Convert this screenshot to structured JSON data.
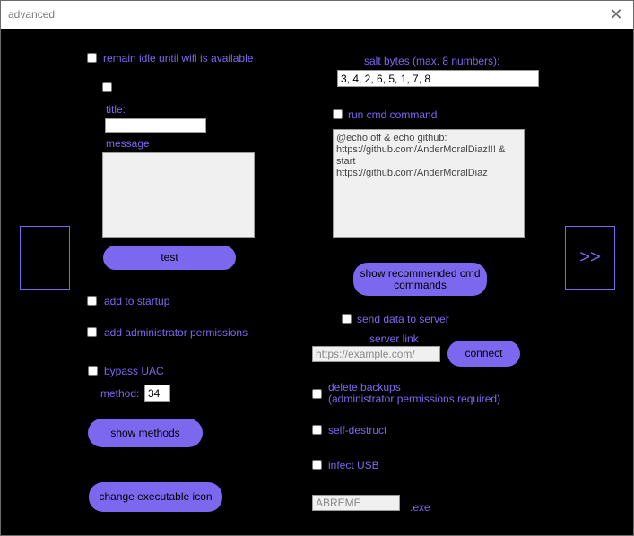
{
  "window": {
    "title": "advanced",
    "close_icon": "✕"
  },
  "left": {
    "remain_idle_label": "remain idle until wifi is available",
    "title_label": "title:",
    "message_label": "message",
    "test_label": "test",
    "startup_label": "add to startup",
    "admin_label": "add administrator permissions",
    "uac_label": "bypass UAC",
    "method_label": "method:",
    "method_value": "34",
    "show_methods_label": "show methods",
    "change_icon_label": "change executable icon"
  },
  "right": {
    "salt_label": "salt bytes (max. 8 numbers):",
    "salt_value": "3, 4, 2, 6, 5, 1, 7, 8",
    "run_cmd_label": "run cmd command",
    "cmd_text": "@echo off & echo github:\nhttps://github.com/AnderMoralDiaz!!! & start\nhttps://github.com/AnderMoralDiaz",
    "show_cmd_label_1": "show recommended cmd",
    "show_cmd_label_2": "commands",
    "send_data_label": "send data to server",
    "server_link_label": "server link",
    "server_link_placeholder": "https://example.com/",
    "connect_label": "connect",
    "delete_backups_label_1": "delete backups",
    "delete_backups_label_2": "(administrator permissions required)",
    "self_destruct_label": "self-destruct",
    "infect_usb_label": "infect USB",
    "exe_name_value": "ABREME",
    "exe_suffix": ".exe"
  },
  "nav": {
    "next_label": ">>"
  }
}
